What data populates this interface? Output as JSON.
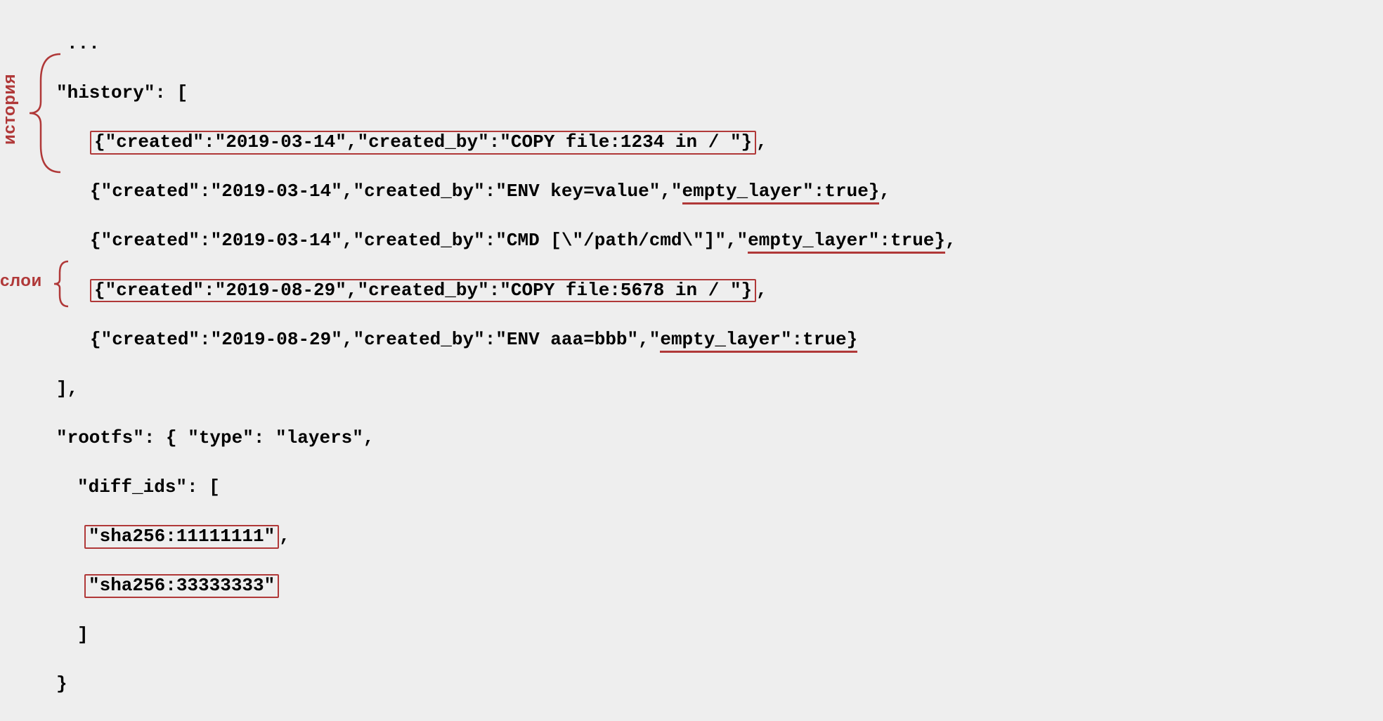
{
  "labels": {
    "history": "история",
    "layers": "слои"
  },
  "json_text": {
    "ellipsis": "...",
    "history_key": "\"history\": [",
    "h1_open": "{\"created\":\"2019-03-14\",\"created_by\":\"COPY file:1234 in / \"}",
    "h1_close": ",",
    "h2_a": "{\"created\":\"2019-03-14\",\"created_by\":\"ENV key=value\",\"",
    "h2_empty": "empty_layer\":true}",
    "h2_close": ",",
    "h3_a": "{\"created\":\"2019-03-14\",\"created_by\":\"CMD [\\\"/path/cmd\\\"]\",\"",
    "h3_empty": "empty_layer\":true}",
    "h3_close": ",",
    "h4_open": "{\"created\":\"2019-08-29\",\"created_by\":\"COPY file:5678 in / \"}",
    "h4_close": ",",
    "h5_a": "{\"created\":\"2019-08-29\",\"created_by\":\"ENV aaa=bbb\",\"",
    "h5_empty": "empty_layer\":true}",
    "close_hist": "],",
    "rootfs": "\"rootfs\": { \"type\": \"layers\",",
    "diff_ids": "\"diff_ids\": [",
    "sha1": "\"sha256:11111111\"",
    "sha1_close": ",",
    "sha2": "\"sha256:33333333\"",
    "close_arr": "]",
    "close_brace": "}"
  },
  "history_data": [
    {
      "created": "2019-03-14",
      "created_by": "COPY file:1234 in / ",
      "boxed": true
    },
    {
      "created": "2019-03-14",
      "created_by": "ENV key=value",
      "empty_layer": true
    },
    {
      "created": "2019-03-14",
      "created_by": "CMD [\"/path/cmd\"]",
      "empty_layer": true
    },
    {
      "created": "2019-08-29",
      "created_by": "COPY file:5678 in / ",
      "boxed": true
    },
    {
      "created": "2019-08-29",
      "created_by": "ENV aaa=bbb",
      "empty_layer": true
    }
  ],
  "rootfs_data": {
    "type": "layers",
    "diff_ids": [
      "sha256:11111111",
      "sha256:33333333"
    ]
  }
}
